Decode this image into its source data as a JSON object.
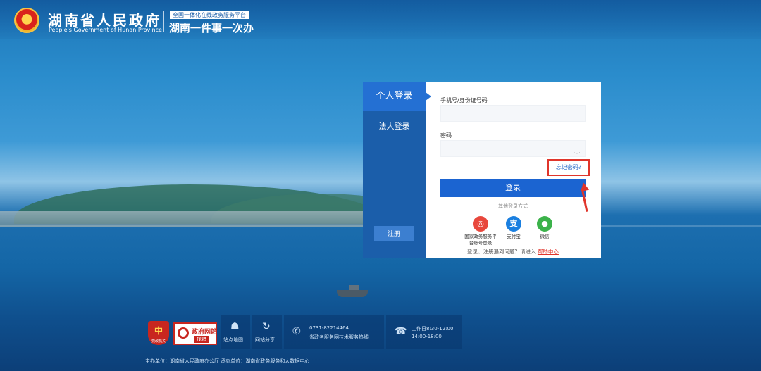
{
  "header": {
    "gov_name_cn": "湖南省人民政府",
    "gov_name_en": "People's Government of Hunan Province",
    "platform_tag": "全国一体化在线政务服务平台",
    "platform_name": "湖南一件事一次办"
  },
  "login": {
    "tabs": [
      {
        "label": "个人登录",
        "active": true
      },
      {
        "label": "法人登录",
        "active": false
      }
    ],
    "register_label": "注册",
    "account_label": "手机号/身份证号码",
    "account_value": "",
    "password_label": "密码",
    "password_value": "",
    "password_toggle_icon": "eye-closed-icon",
    "forgot_label": "忘记密码?",
    "login_button": "登录",
    "other_methods_label": "其他登录方式",
    "alt_methods": [
      {
        "label": "国家政务服务平台账号登录",
        "icon": "national-platform-icon",
        "color": "#e8473c"
      },
      {
        "label": "支付宝",
        "icon": "alipay-icon",
        "color": "#1a7fe0"
      },
      {
        "label": "微信",
        "icon": "wechat-icon",
        "color": "#3bb24a"
      }
    ],
    "help_text": "登录、注册遇到问题？请进入",
    "help_link": "帮助中心"
  },
  "footer": {
    "police_badge_text": "党政机关",
    "gov_site_title": "政府网站",
    "gov_site_tag": "找错",
    "sitemap_label": "站点地图",
    "share_label": "网站分享",
    "hotline_number": "0731-82214464",
    "hotline_desc": "省政务服务网技术服务热线",
    "hours_line1": "工作日8:30-12:00",
    "hours_line2": "14:00-18:00",
    "copyright": "主办单位：湖南省人民政府办公厅    承办单位：湖南省政务服务和大数据中心"
  },
  "colors": {
    "primary": "#1b64d1",
    "sidebar": "#1b5eaa",
    "highlight": "#e0352b"
  }
}
